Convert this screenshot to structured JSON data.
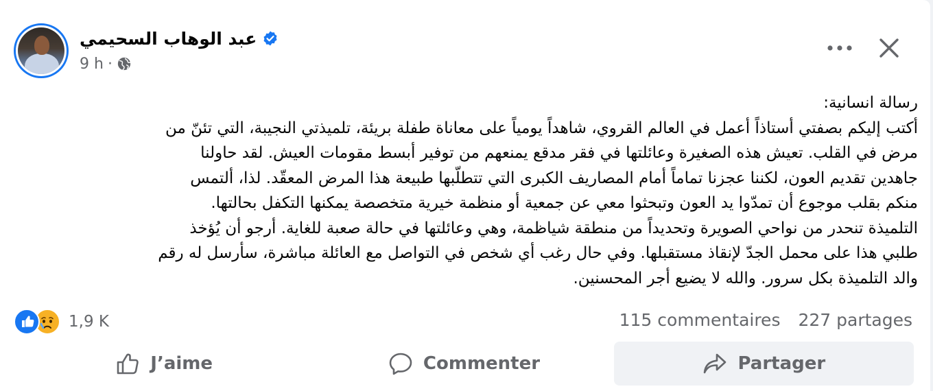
{
  "post": {
    "author": "عبد الوهاب السحيمي",
    "time": "9 h",
    "separator": "·",
    "text_lines": [
      "رسالة انسانية:",
      "أكتب إليكم بصفتي أستاذاً أعمل في العالم القروي، شاهداً يومياً على معاناة طفلة بريئة، تلميذتي النجيبة، التي تئنّ من",
      "مرض في القلب. تعيش هذه الصغيرة وعائلتها في فقر مدقع يمنعهم من توفير أبسط مقومات العيش. لقد حاولنا",
      "جاهدين تقديم العون، لكننا عجزنا تماماً أمام المصاريف الكبرى التي تتطلّبها طبيعة هذا المرض المعقّد. لذا، ألتمس",
      "منكم بقلب موجوع أن تمدّوا يد العون وتبحثوا معي عن جمعية أو منظمة خيرية متخصصة يمكنها التكفل بحالتها.",
      "التلميذة تنحدر من نواحي الصويرة وتحديداً من منطقة شياظمة، وهي وعائلتها في حالة صعبة للغاية. أرجو أن يُؤخذ",
      "طلبي هذا على محمل الجدّ لإنقاذ مستقبلها. وفي حال رغب أي شخص في التواصل مع العائلة مباشرة، سأرسل له رقم",
      "والد التلميذة بكل سرور. والله لا يضيع أجر المحسنين."
    ]
  },
  "stats": {
    "reactions_count": "1,9 K",
    "comments": "115 commentaires",
    "shares": "227 partages"
  },
  "actions": {
    "like_label": "J’aime",
    "comment_label": "Commenter",
    "share_label": "Partager"
  },
  "icons": {
    "verified": "verified-badge-icon",
    "audience": "globe-icon",
    "more": "more-dots-icon",
    "close": "close-icon",
    "like": "thumbs-up-icon",
    "comment": "comment-bubble-icon",
    "share": "share-arrow-icon"
  },
  "colors": {
    "brand_blue": "#1877f2",
    "secondary_text": "#65676b",
    "primary_text": "#050505",
    "hover_bg": "#f0f2f5"
  }
}
